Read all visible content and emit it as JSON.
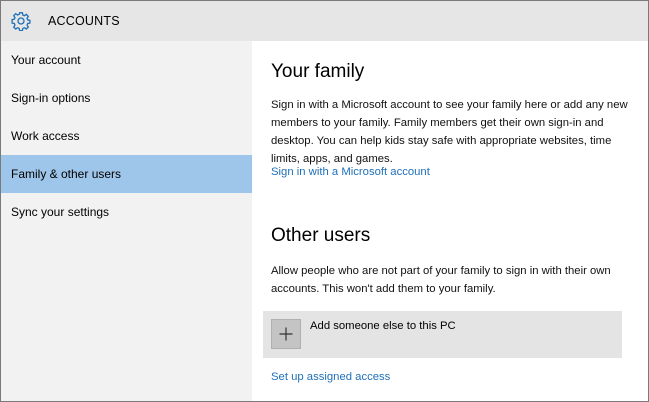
{
  "header": {
    "title": "ACCOUNTS",
    "icon": "gear-icon",
    "accent": "#1f6fb7"
  },
  "sidebar": {
    "items": [
      {
        "label": "Your account"
      },
      {
        "label": "Sign-in options"
      },
      {
        "label": "Work access"
      },
      {
        "label": "Family & other users",
        "selected": true
      },
      {
        "label": "Sync your settings"
      }
    ],
    "selected_color": "#9ec6ea"
  },
  "family": {
    "title": "Your family",
    "description": "Sign in with a Microsoft account to see your family here or add any new members to your family. Family members get their own sign-in and desktop. You can help kids stay safe with appropriate websites, time limits, apps, and games.",
    "link": "Sign in with a Microsoft account"
  },
  "other_users": {
    "title": "Other users",
    "description": "Allow people who are not part of your family to sign in with their own accounts. This won't add them to your family.",
    "add_label": "Add someone else to this PC",
    "add_icon": "plus-icon",
    "link": "Set up assigned access"
  }
}
